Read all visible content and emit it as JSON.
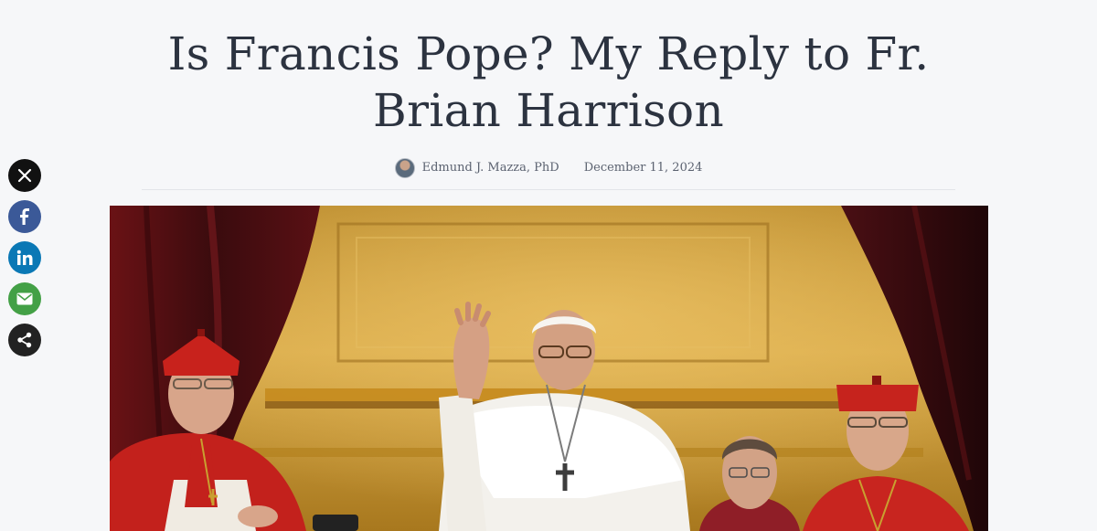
{
  "article": {
    "title": "Is Francis Pope? My Reply to Fr. Brian Harrison",
    "author": "Edmund J. Mazza, PhD",
    "date": "December 11, 2024"
  },
  "share": [
    {
      "name": "x-icon",
      "color": "#111111"
    },
    {
      "name": "facebook-icon",
      "color": "#3b5998"
    },
    {
      "name": "linkedin-icon",
      "color": "#0a78b5"
    },
    {
      "name": "email-icon",
      "color": "#43a046"
    },
    {
      "name": "share-icon",
      "color": "#222222"
    }
  ],
  "colors": {
    "background": "#f6f7f9",
    "title": "#2c3340",
    "meta": "#5b6270"
  }
}
